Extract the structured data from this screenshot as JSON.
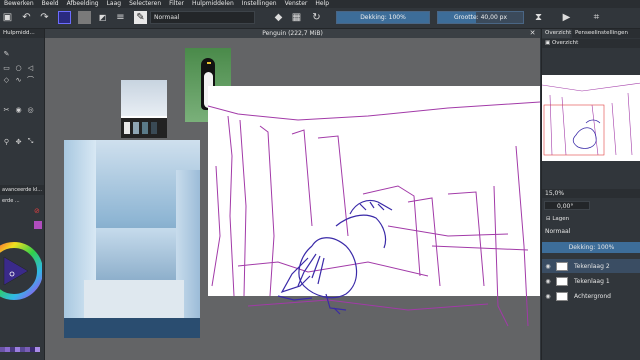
{
  "menubar": {
    "items": [
      "Bewerken",
      "Beeld",
      "Afbeelding",
      "Laag",
      "Selecteren",
      "Filter",
      "Hulpmiddelen",
      "Instellingen",
      "Venster",
      "Help"
    ]
  },
  "toolbar": {
    "blend_mode": "Normaal",
    "opacity_label": "Dekking: 100%",
    "opacity_value": 1.0,
    "size_label": "Grootte: 40,00 px",
    "size_value": 0.45,
    "colors": {
      "fg": "#1d1d6b",
      "bg": "#888888",
      "accent": "#3d6d99"
    }
  },
  "left_panel": {
    "tab_label": "Hulpmidd...",
    "advanced_label": "avanceerde kl...",
    "brush_label": "erde ..."
  },
  "document": {
    "title": "Penguin (222,7 MiB)"
  },
  "right_panel": {
    "tabs": [
      "Overzicht",
      "Penseelinstellingen"
    ],
    "overview_label": "Overzicht",
    "zoom": "15,0%",
    "rotation": "0,00°",
    "layers_label": "Lagen",
    "layer_blend": "Normaal",
    "layer_opacity": "Dekking: 100%",
    "layers": [
      {
        "name": "Tekenlaag 2",
        "selected": true
      },
      {
        "name": "Tekenlaag 1",
        "selected": false
      },
      {
        "name": "Achtergrond",
        "selected": false
      }
    ]
  }
}
